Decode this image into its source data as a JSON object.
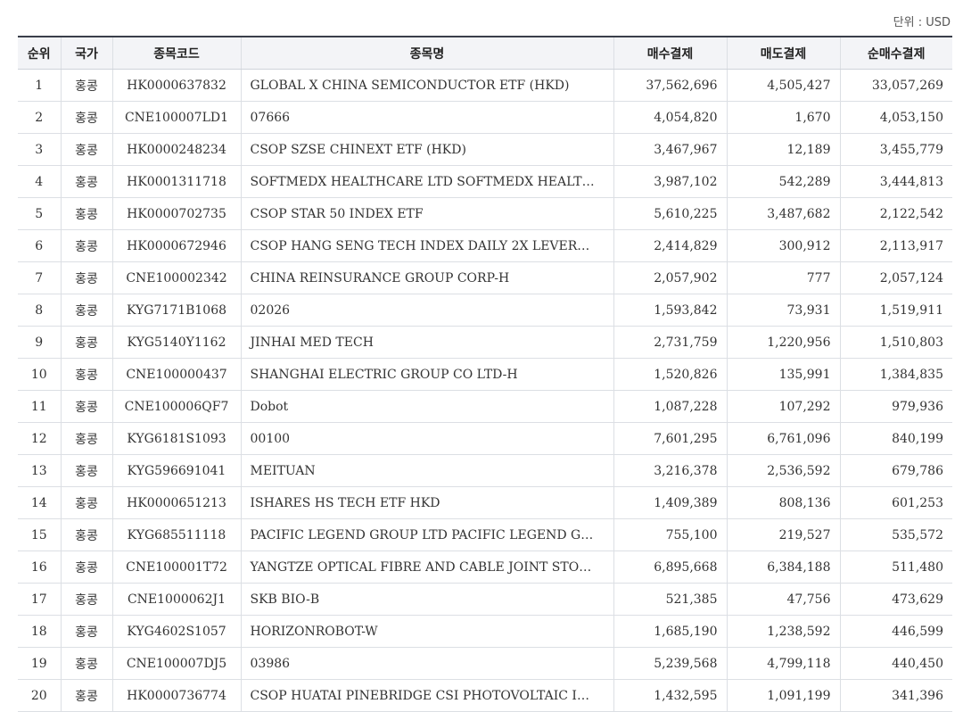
{
  "unit_label": "단위 : USD",
  "columns": [
    "순위",
    "국가",
    "종목코드",
    "종목명",
    "매수결제",
    "매도결제",
    "순매수결제"
  ],
  "rows": [
    [
      "1",
      "홍콩",
      "HK0000637832",
      "GLOBAL X CHINA SEMICONDUCTOR ETF (HKD)",
      "37,562,696",
      "4,505,427",
      "33,057,269"
    ],
    [
      "2",
      "홍콩",
      "CNE100007LD1",
      "07666",
      "4,054,820",
      "1,670",
      "4,053,150"
    ],
    [
      "3",
      "홍콩",
      "HK0000248234",
      "CSOP SZSE CHINEXT ETF (HKD)",
      "3,467,967",
      "12,189",
      "3,455,779"
    ],
    [
      "4",
      "홍콩",
      "HK0001311718",
      "SOFTMEDX HEALTHCARE LTD SOFTMEDX HEALT…",
      "3,987,102",
      "542,289",
      "3,444,813"
    ],
    [
      "5",
      "홍콩",
      "HK0000702735",
      "CSOP STAR 50 INDEX ETF",
      "5,610,225",
      "3,487,682",
      "2,122,542"
    ],
    [
      "6",
      "홍콩",
      "HK0000672946",
      "CSOP HANG SENG TECH INDEX DAILY 2X LEVER…",
      "2,414,829",
      "300,912",
      "2,113,917"
    ],
    [
      "7",
      "홍콩",
      "CNE100002342",
      "CHINA REINSURANCE GROUP CORP-H",
      "2,057,902",
      "777",
      "2,057,124"
    ],
    [
      "8",
      "홍콩",
      "KYG7171B1068",
      "02026",
      "1,593,842",
      "73,931",
      "1,519,911"
    ],
    [
      "9",
      "홍콩",
      "KYG5140Y1162",
      "JINHAI MED TECH",
      "2,731,759",
      "1,220,956",
      "1,510,803"
    ],
    [
      "10",
      "홍콩",
      "CNE100000437",
      "SHANGHAI ELECTRIC GROUP CO LTD-H",
      "1,520,826",
      "135,991",
      "1,384,835"
    ],
    [
      "11",
      "홍콩",
      "CNE100006QF7",
      "Dobot",
      "1,087,228",
      "107,292",
      "979,936"
    ],
    [
      "12",
      "홍콩",
      "KYG6181S1093",
      "00100",
      "7,601,295",
      "6,761,096",
      "840,199"
    ],
    [
      "13",
      "홍콩",
      "KYG596691041",
      "MEITUAN",
      "3,216,378",
      "2,536,592",
      "679,786"
    ],
    [
      "14",
      "홍콩",
      "HK0000651213",
      "ISHARES HS TECH ETF HKD",
      "1,409,389",
      "808,136",
      "601,253"
    ],
    [
      "15",
      "홍콩",
      "KYG685511118",
      "PACIFIC LEGEND GROUP LTD PACIFIC LEGEND G…",
      "755,100",
      "219,527",
      "535,572"
    ],
    [
      "16",
      "홍콩",
      "CNE100001T72",
      "YANGTZE OPTICAL FIBRE AND CABLE JOINT STO…",
      "6,895,668",
      "6,384,188",
      "511,480"
    ],
    [
      "17",
      "홍콩",
      "CNE1000062J1",
      "SKB BIO-B",
      "521,385",
      "47,756",
      "473,629"
    ],
    [
      "18",
      "홍콩",
      "KYG4602S1057",
      "HORIZONROBOT-W",
      "1,685,190",
      "1,238,592",
      "446,599"
    ],
    [
      "19",
      "홍콩",
      "CNE100007DJ5",
      "03986",
      "5,239,568",
      "4,799,118",
      "440,450"
    ],
    [
      "20",
      "홍콩",
      "HK0000736774",
      "CSOP HUATAI PINEBRIDGE CSI PHOTOVOLTAIC I…",
      "1,432,595",
      "1,091,199",
      "341,396"
    ]
  ]
}
